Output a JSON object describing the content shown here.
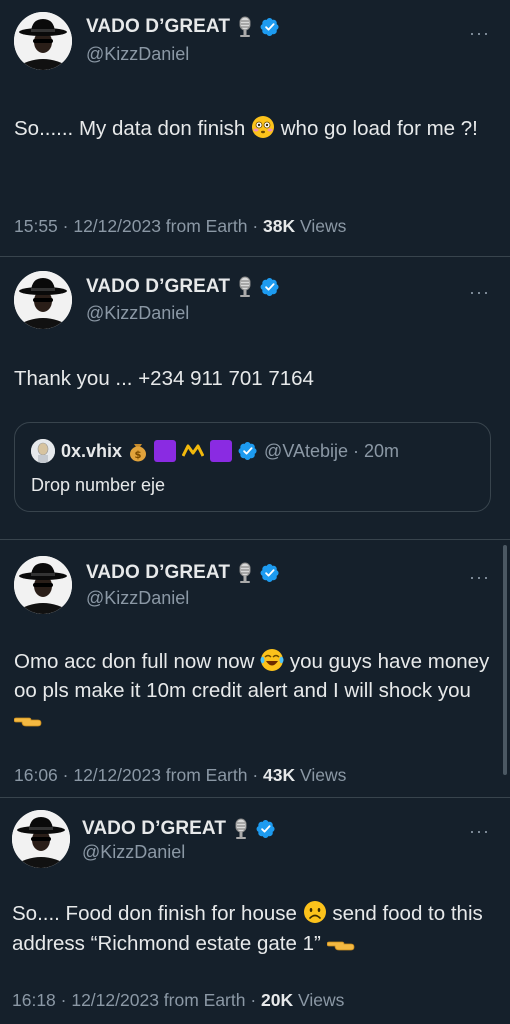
{
  "tweets": [
    {
      "name": "VADO D’GREAT",
      "handle": "@KizzDaniel",
      "text_before_emoji": "So...... My data don finish",
      "text_after_emoji": "who go load for me ?!",
      "emoji_icon": "flushed-face-emoji",
      "time": "15:55 · 12/12/2023 from Earth ·",
      "views_count": "38K",
      "views_label": "Views"
    },
    {
      "name": "VADO D’GREAT",
      "handle": "@KizzDaniel",
      "text": "Thank you ... +234 911 701 7164",
      "quote": {
        "name": "0x.vhix",
        "handle": "@VAtebije · 20m",
        "text": "Drop number eje"
      }
    },
    {
      "name": "VADO D’GREAT",
      "handle": "@KizzDaniel",
      "text_before_emoji": "Omo acc don full now now",
      "text_after_emoji": "you guys have money oo pls make it 10m credit alert and I will shock you",
      "emoji_icon": "tears-of-joy-emoji",
      "time": "16:06 · 12/12/2023 from Earth ·",
      "views_count": "43K",
      "views_label": "Views"
    },
    {
      "name": "VADO D’GREAT",
      "handle": "@KizzDaniel",
      "text_before_emoji": "So.... Food don finish for house",
      "text_after_emoji": "send food to this address “Richmond estate gate 1”",
      "emoji_icon": "frowning-face-emoji",
      "time": "16:18 · 12/12/2023 from Earth ·",
      "views_count": "20K",
      "views_label": "Views"
    }
  ],
  "colors": {
    "background": "#15202b",
    "text": "#e7e9ea",
    "secondary": "#8b98a5",
    "verified": "#1d9bf0",
    "divider": "#38444d"
  }
}
